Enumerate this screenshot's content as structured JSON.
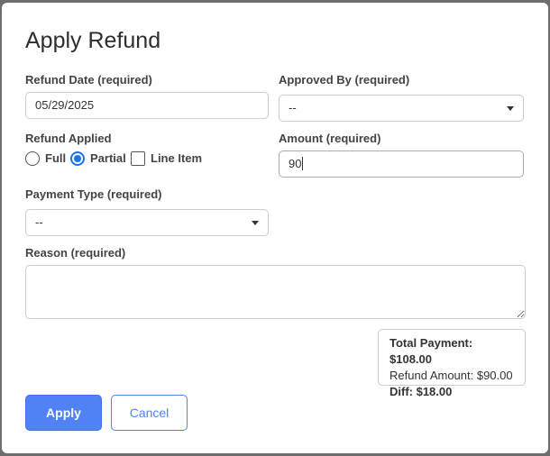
{
  "dialog": {
    "title": "Apply Refund",
    "refund_date": {
      "label": "Refund Date",
      "required": "(required)",
      "value": "05/29/2025"
    },
    "approved_by": {
      "label": "Approved By",
      "required": "(required)",
      "value": "--"
    },
    "refund_applied": {
      "label": "Refund Applied",
      "options": [
        {
          "label": "Full",
          "selected": false
        },
        {
          "label": "Partial",
          "selected": true
        },
        {
          "label": "Line Item",
          "selected": false
        }
      ]
    },
    "amount": {
      "label": "Amount",
      "required": "(required)",
      "value": "90"
    },
    "payment_type": {
      "label": "Payment Type",
      "required": "(required)",
      "value": "--"
    },
    "reason": {
      "label": "Reason",
      "required": "(required)",
      "value": ""
    },
    "summary": {
      "total_payment": "Total Payment: $108.00",
      "refund_amount": "Refund Amount: $90.00",
      "diff": "Diff: $18.00"
    },
    "buttons": {
      "apply": "Apply",
      "cancel": "Cancel"
    },
    "colors": {
      "accent": "#4f83f5",
      "radio_selected": "#1a73e8"
    }
  }
}
